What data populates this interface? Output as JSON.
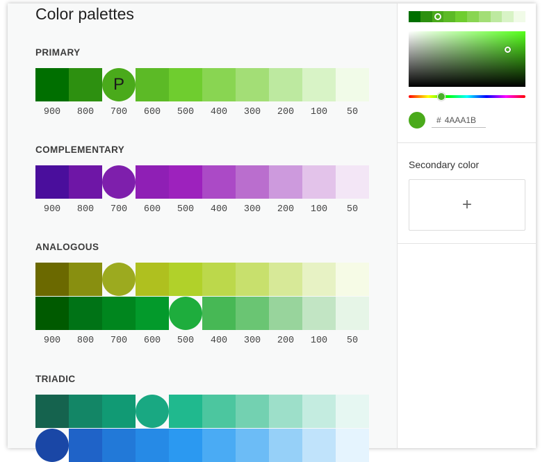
{
  "page_title": "Color palettes",
  "shade_labels": [
    "900",
    "800",
    "700",
    "600",
    "500",
    "400",
    "300",
    "200",
    "100",
    "50"
  ],
  "sections": [
    {
      "title": "PRIMARY",
      "rows": [
        {
          "colors": [
            "#006f00",
            "#2d9010",
            "#4aaa1b",
            "#5cba26",
            "#6fcd2f",
            "#89d552",
            "#a3de76",
            "#bde9a0",
            "#d8f3c6",
            "#f1fbe8"
          ],
          "selected_index": 2,
          "selected_letter": "P"
        }
      ]
    },
    {
      "title": "COMPLEMENTARY",
      "rows": [
        {
          "colors": [
            "#4a0e9c",
            "#6e16a6",
            "#7e1fac",
            "#8f1fb5",
            "#9d22bd",
            "#ab4ac6",
            "#ba6ece",
            "#cd9add",
            "#e3c3ea",
            "#f3e6f6"
          ],
          "selected_index": 2,
          "selected_letter": ""
        }
      ]
    },
    {
      "title": "ANALOGOUS",
      "rows": [
        {
          "colors": [
            "#6b6900",
            "#888f10",
            "#9caa1f",
            "#afc01f",
            "#b1d12a",
            "#bcd84b",
            "#c8e06d",
            "#d7e998",
            "#e7f2c4",
            "#f6fbe6"
          ],
          "selected_index": 2,
          "selected_letter": ""
        },
        {
          "colors": [
            "#005a00",
            "#007316",
            "#00861e",
            "#039a2b",
            "#1ead3d",
            "#47b855",
            "#6ac573",
            "#98d49c",
            "#c2e5c4",
            "#e6f5e7"
          ],
          "selected_index": 4,
          "selected_letter": ""
        }
      ]
    },
    {
      "title": "TRIADIC",
      "rows": [
        {
          "colors": [
            "#15634e",
            "#138666",
            "#119a74",
            "#19a882",
            "#20b98e",
            "#4cc69f",
            "#73d1b1",
            "#9ddfc9",
            "#c4ece0",
            "#e6f7f2"
          ],
          "selected_index": 3,
          "selected_letter": ""
        },
        {
          "colors": [
            "#1a47a6",
            "#1f63c8",
            "#2279d8",
            "#268ae6",
            "#2b99f1",
            "#4aabf4",
            "#6cbcf6",
            "#96d0f8",
            "#c0e3fb",
            "#e5f4fe"
          ],
          "selected_index": 0,
          "selected_letter": ""
        }
      ]
    }
  ],
  "picker": {
    "tones": [
      "#006f00",
      "#2d9010",
      "#4aaa1b",
      "#5cba26",
      "#6fcd2f",
      "#89d552",
      "#a3de76",
      "#bde9a0",
      "#d8f3c6",
      "#f1fbe8"
    ],
    "selected_tone_index": 2,
    "current_color": "#4aaa1b",
    "hex_prefix": "#",
    "hex_value": "4AAA1B"
  },
  "secondary": {
    "title": "Secondary color",
    "add_label": "+"
  }
}
